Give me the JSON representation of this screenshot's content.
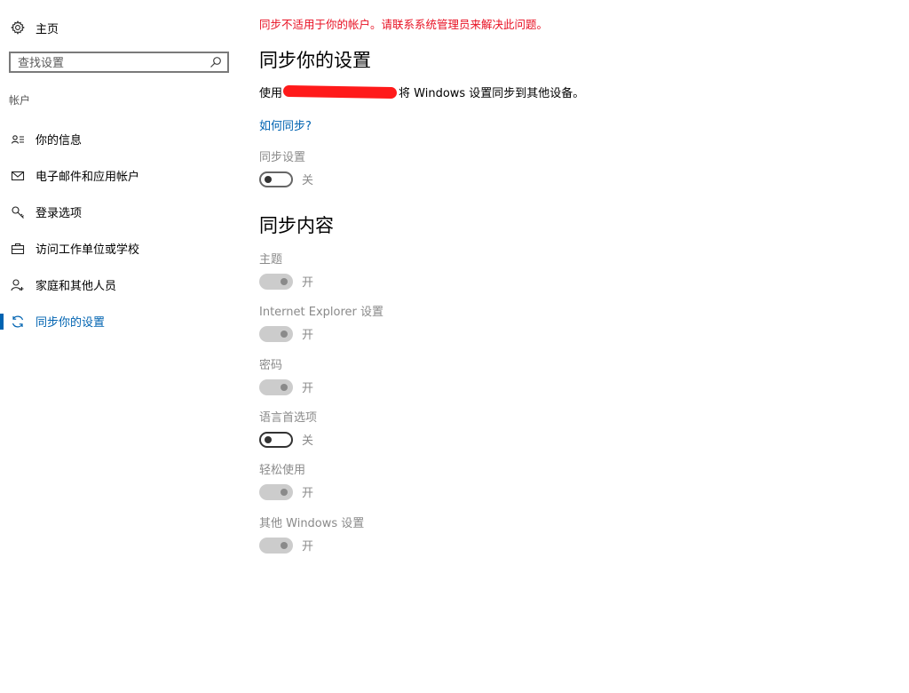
{
  "sidebar": {
    "home_label": "主页",
    "search_placeholder": "查找设置",
    "section_label": "帐户",
    "items": [
      {
        "label": "你的信息",
        "icon": "person-card-icon"
      },
      {
        "label": "电子邮件和应用帐户",
        "icon": "mail-icon"
      },
      {
        "label": "登录选项",
        "icon": "key-icon"
      },
      {
        "label": "访问工作单位或学校",
        "icon": "briefcase-icon"
      },
      {
        "label": "家庭和其他人员",
        "icon": "person-add-icon"
      },
      {
        "label": "同步你的设置",
        "icon": "sync-icon",
        "active": true
      }
    ]
  },
  "main": {
    "error_text": "同步不适用于你的帐户。请联系系统管理员来解决此问题。",
    "title": "同步你的设置",
    "description_prefix": "使用",
    "description_suffix": "将 Windows 设置同步到其他设备。",
    "help_link": "如何同步?",
    "sync_settings": {
      "label": "同步设置",
      "state": "关"
    },
    "content_title": "同步内容",
    "content_items": [
      {
        "label": "主题",
        "state": "开"
      },
      {
        "label": "Internet Explorer 设置",
        "state": "开"
      },
      {
        "label": "密码",
        "state": "开"
      },
      {
        "label": "语言首选项",
        "state": "关"
      },
      {
        "label": "轻松使用",
        "state": "开"
      },
      {
        "label": "其他 Windows 设置",
        "state": "开"
      }
    ]
  },
  "colors": {
    "accent": "#0063b1",
    "error": "#e81123",
    "disabled_text": "#8a8a8a",
    "redaction": "#ff1a1a"
  }
}
